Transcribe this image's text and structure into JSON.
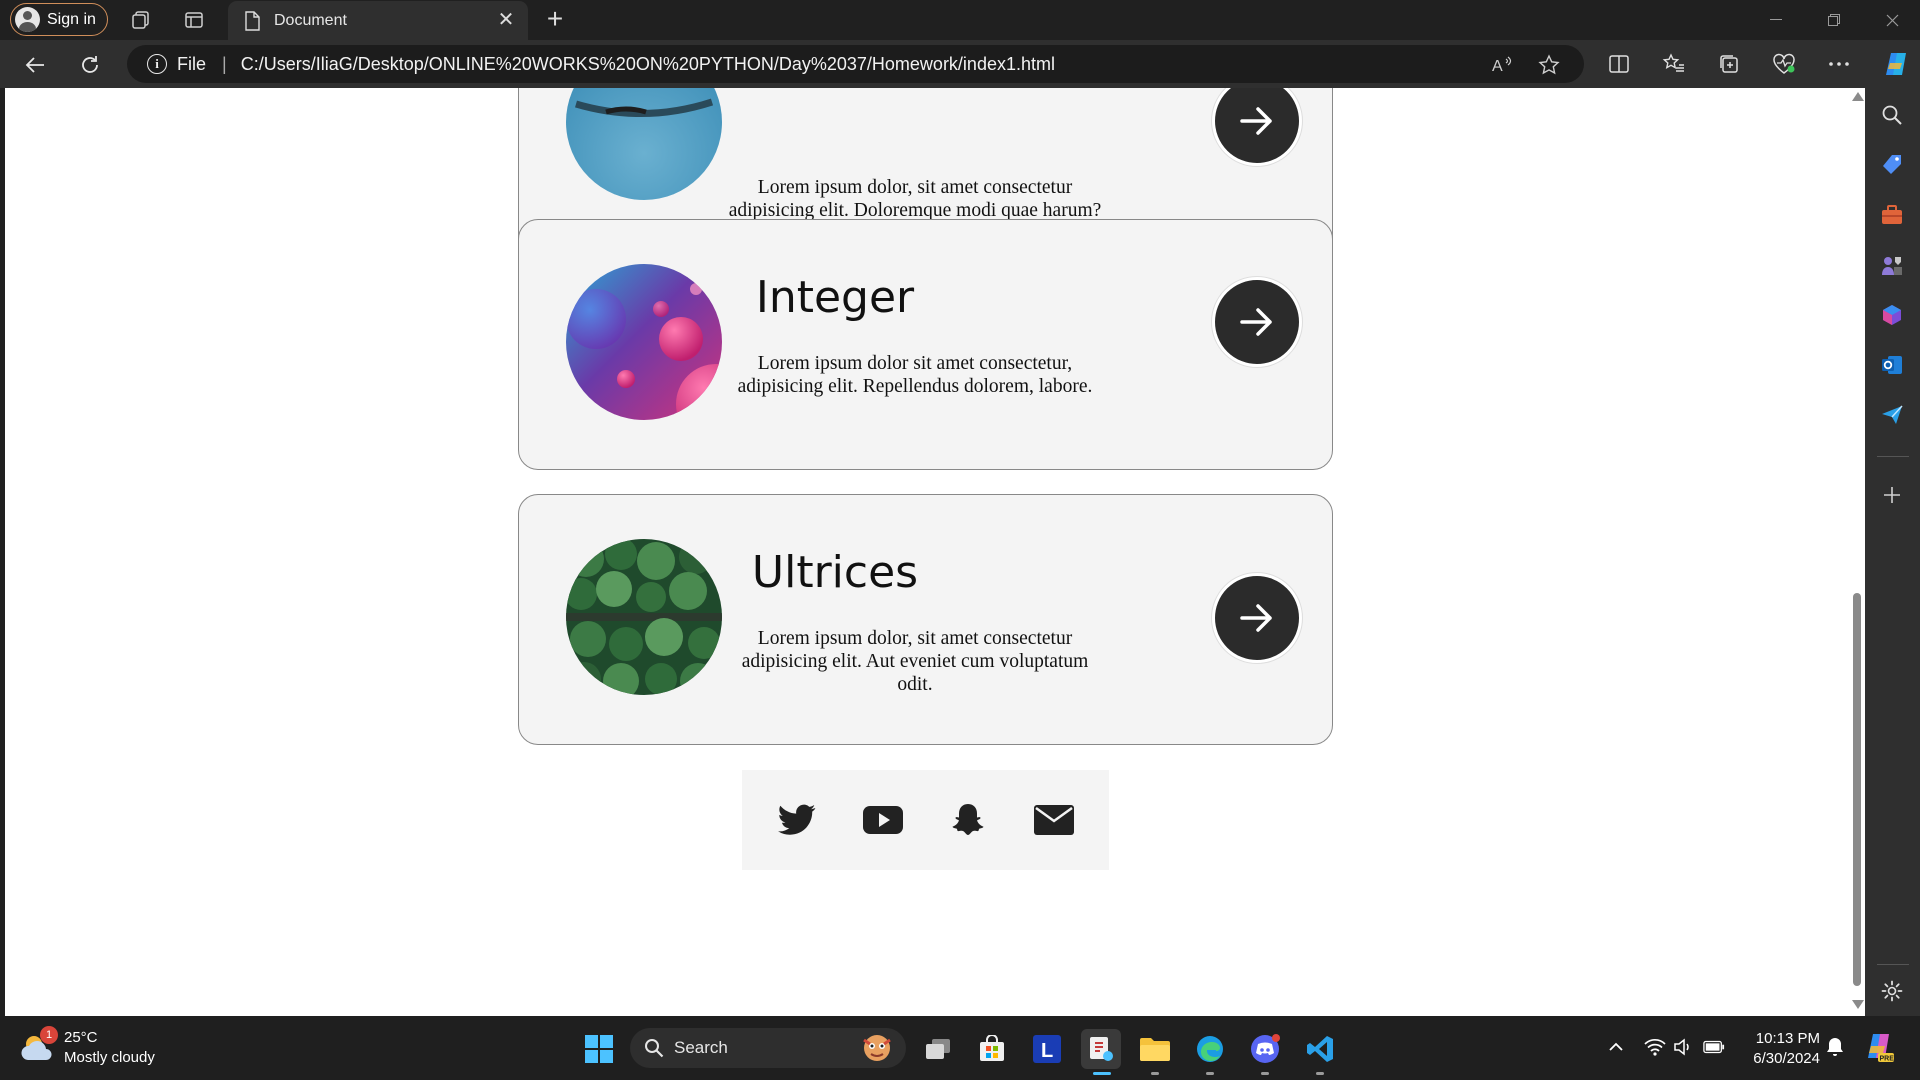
{
  "browser": {
    "profile_label": "Sign in",
    "tab_title": "Document",
    "url_scheme_label": "File",
    "url": "C:/Users/IliaG/Desktop/ONLINE%20WORKS%20ON%20PYTHON/Day%2037/Homework/index1.html"
  },
  "page": {
    "cards": [
      {
        "title": "",
        "text": "Lorem ipsum dolor, sit amet consectetur adipisicing elit. Doloremque modi quae harum?",
        "image": "blue-sea-photo",
        "partially_visible": true
      },
      {
        "title": "Integer",
        "text": "Lorem ipsum dolor sit amet consectetur, adipisicing elit. Repellendus dolorem, labore.",
        "image": "pink-spheres-abstract"
      },
      {
        "title": "Ultrices",
        "text": "Lorem ipsum dolor, sit amet consectetur adipisicing elit. Aut eveniet cum voluptatum odit.",
        "image": "aerial-forest-road"
      }
    ],
    "social_icons": [
      "twitter-icon",
      "youtube-icon",
      "snapchat-icon",
      "mail-icon"
    ]
  },
  "taskbar": {
    "weather_temp": "25°C",
    "weather_desc": "Mostly cloudy",
    "weather_badge": "1",
    "search_label": "Search",
    "time": "10:13 PM",
    "date": "6/30/2024"
  }
}
